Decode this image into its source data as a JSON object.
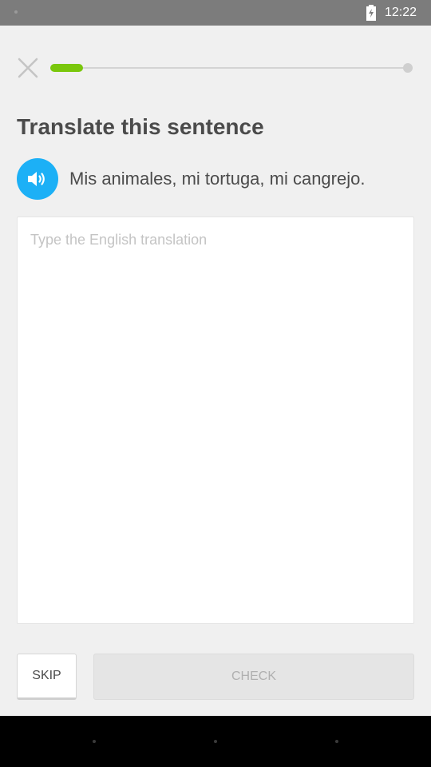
{
  "status_bar": {
    "time": "12:22"
  },
  "icons": {
    "close": "close-icon",
    "speaker": "speaker-icon",
    "battery": "battery-charging-icon"
  },
  "progress": {
    "fraction": 0.09
  },
  "exercise": {
    "heading": "Translate this sentence",
    "sentence": "Mis animales, mi tortuga, mi cangrejo.",
    "placeholder": "Type the English translation",
    "value": ""
  },
  "actions": {
    "skip_label": "SKIP",
    "check_label": "CHECK"
  },
  "colors": {
    "accent_blue": "#1cb0f6",
    "progress_green": "#7ac70c",
    "text": "#4b4b4b",
    "disabled_button": "#e5e5e5"
  }
}
